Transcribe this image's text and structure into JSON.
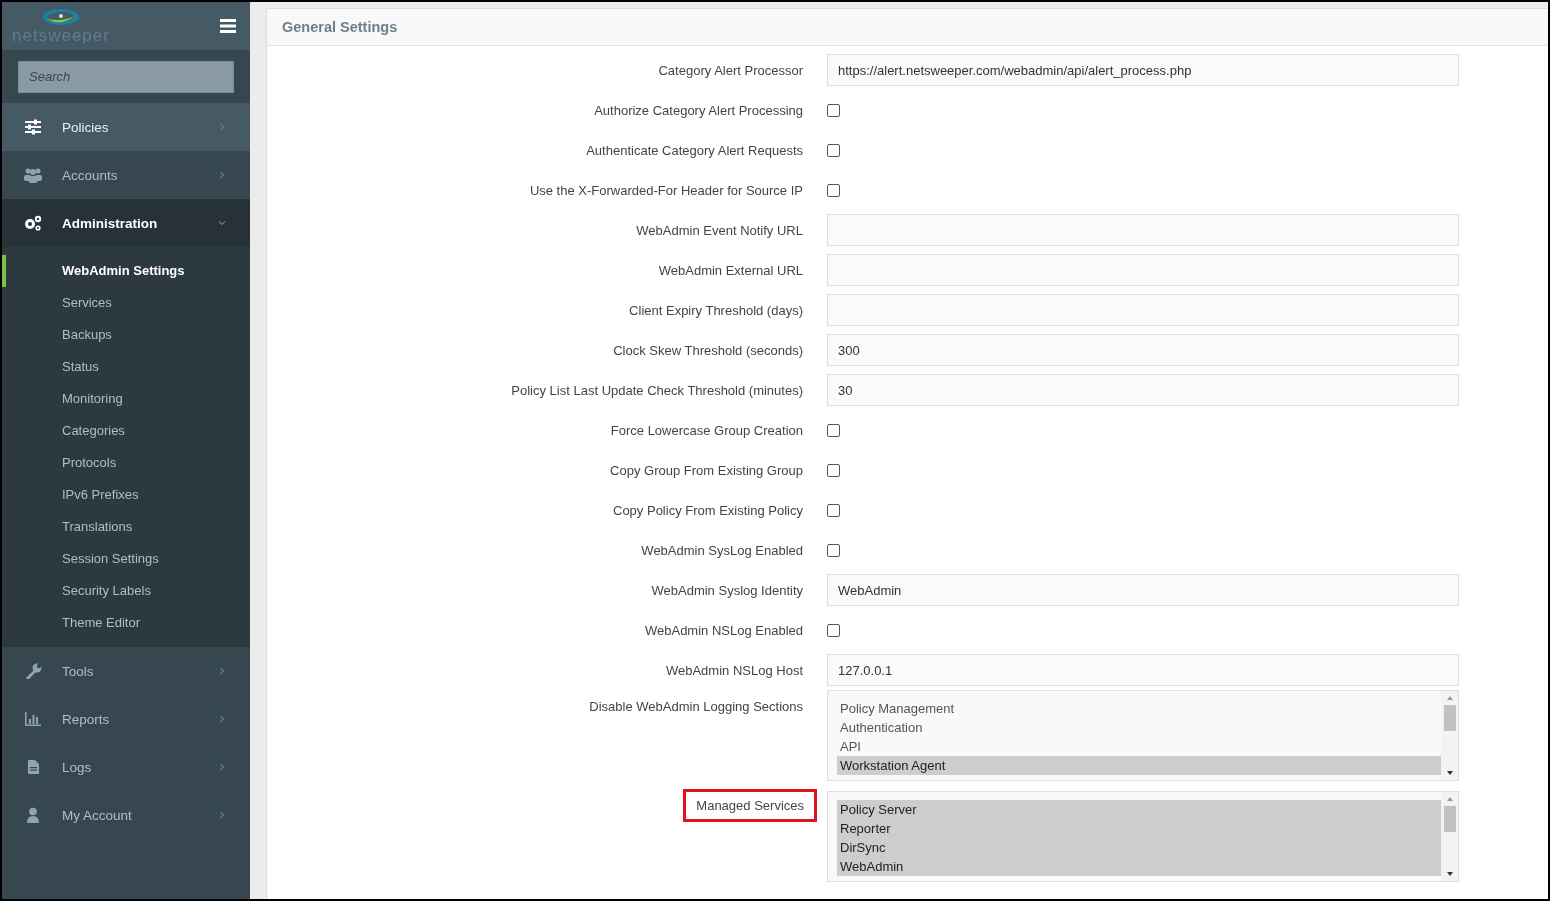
{
  "sidebar": {
    "logo": "netsweeper",
    "search": {
      "placeholder": "Search"
    },
    "items": [
      {
        "label": "Policies",
        "hovered": true,
        "expanded": false
      },
      {
        "label": "Accounts",
        "hovered": false,
        "expanded": false
      },
      {
        "label": "Administration",
        "hovered": false,
        "expanded": true,
        "children": [
          {
            "label": "WebAdmin Settings",
            "selected": true
          },
          {
            "label": "Services",
            "selected": false
          },
          {
            "label": "Backups",
            "selected": false
          },
          {
            "label": "Status",
            "selected": false
          },
          {
            "label": "Monitoring",
            "selected": false
          },
          {
            "label": "Categories",
            "selected": false
          },
          {
            "label": "Protocols",
            "selected": false
          },
          {
            "label": "IPv6 Prefixes",
            "selected": false
          },
          {
            "label": "Translations",
            "selected": false
          },
          {
            "label": "Session Settings",
            "selected": false
          },
          {
            "label": "Security Labels",
            "selected": false
          },
          {
            "label": "Theme Editor",
            "selected": false
          }
        ]
      },
      {
        "label": "Tools",
        "hovered": false,
        "expanded": false
      },
      {
        "label": "Reports",
        "hovered": false,
        "expanded": false
      },
      {
        "label": "Logs",
        "hovered": false,
        "expanded": false
      },
      {
        "label": "My Account",
        "hovered": false,
        "expanded": false
      }
    ]
  },
  "panel": {
    "title": "General Settings",
    "fields": [
      {
        "kind": "text",
        "label": "Category Alert Processor",
        "value": "https://alert.netsweeper.com/webadmin/api/alert_process.php"
      },
      {
        "kind": "checkbox",
        "label": "Authorize Category Alert Processing",
        "checked": false
      },
      {
        "kind": "checkbox",
        "label": "Authenticate Category Alert Requests",
        "checked": false
      },
      {
        "kind": "checkbox",
        "label": "Use the X-Forwarded-For Header for Source IP",
        "checked": false
      },
      {
        "kind": "text",
        "label": "WebAdmin Event Notify URL"
      },
      {
        "kind": "text",
        "label": "WebAdmin External URL"
      },
      {
        "kind": "text",
        "label": "Client Expiry Threshold (days)"
      },
      {
        "kind": "text",
        "label": "Clock Skew Threshold (seconds)",
        "value": "300"
      },
      {
        "kind": "text",
        "label": "Policy List Last Update Check Threshold (minutes)",
        "value": "30"
      },
      {
        "kind": "checkbox",
        "label": "Force Lowercase Group Creation",
        "checked": false
      },
      {
        "kind": "checkbox",
        "label": "Copy Group From Existing Group",
        "checked": false
      },
      {
        "kind": "checkbox",
        "label": "Copy Policy From Existing Policy",
        "checked": false
      },
      {
        "kind": "checkbox",
        "label": "WebAdmin SysLog Enabled",
        "checked": false
      },
      {
        "kind": "text",
        "label": "WebAdmin Syslog Identity",
        "value": "WebAdmin"
      },
      {
        "kind": "checkbox",
        "label": "WebAdmin NSLog Enabled",
        "checked": false
      },
      {
        "kind": "text",
        "label": "WebAdmin NSLog Host",
        "value": "127.0.0.1"
      },
      {
        "kind": "listbox",
        "label": "Disable WebAdmin Logging Sections",
        "highlighted": false,
        "options": [
          {
            "label": "Policy Management",
            "selected": false
          },
          {
            "label": "Authentication",
            "selected": false
          },
          {
            "label": "API",
            "selected": false
          },
          {
            "label": "Workstation Agent",
            "selected": true
          }
        ]
      },
      {
        "kind": "listbox",
        "label": "Managed Services",
        "highlighted": true,
        "options": [
          {
            "label": "Policy Server",
            "selected": true
          },
          {
            "label": "Reporter",
            "selected": true
          },
          {
            "label": "DirSync",
            "selected": true
          },
          {
            "label": "WebAdmin",
            "selected": true
          }
        ]
      }
    ]
  }
}
